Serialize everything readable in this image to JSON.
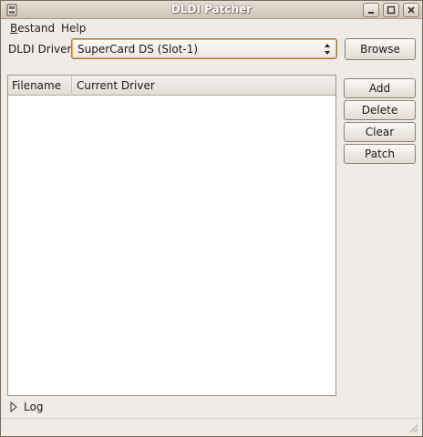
{
  "window": {
    "title": "DLDI Patcher"
  },
  "menu": [
    {
      "label": "Bestand",
      "mnemonic": "B",
      "rest": "estand"
    },
    {
      "label": "Help",
      "mnemonic": "",
      "rest": "Help"
    }
  ],
  "driver": {
    "label": "DLDI Driver:",
    "selected": "SuperCard DS (Slot-1)",
    "browse": "Browse"
  },
  "list": {
    "columns": [
      "Filename",
      "Current Driver"
    ],
    "rows": []
  },
  "actions": {
    "add": "Add",
    "delete": "Delete",
    "clear": "Clear",
    "patch": "Patch"
  },
  "log": {
    "label": "Log"
  },
  "colors": {
    "window_bg": "#efebe7",
    "focus_ring": "#f6a93c",
    "list_bg": "#ffffff"
  }
}
